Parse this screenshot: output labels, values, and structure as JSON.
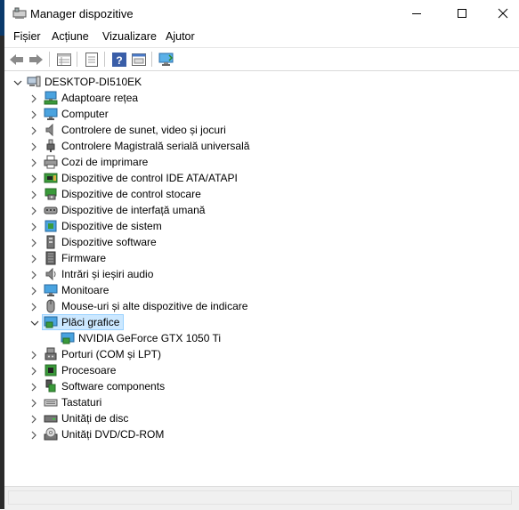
{
  "window": {
    "title": "Manager dispozitive"
  },
  "menu": [
    "Fișier",
    "Acțiune",
    "Vizualizare",
    "Ajutor"
  ],
  "toolbar": [
    "back-arrow-icon",
    "forward-arrow-icon",
    "properties-grid-icon",
    "document-icon",
    "help-icon",
    "panel-icon",
    "monitor-scan-icon"
  ],
  "tree": {
    "root": "DESKTOP-DI510EK",
    "categories": [
      {
        "label": "Adaptoare rețea",
        "icon": "network-icon"
      },
      {
        "label": "Computer",
        "icon": "computer-icon"
      },
      {
        "label": "Controlere de sunet, video și jocuri",
        "icon": "speaker-icon"
      },
      {
        "label": "Controlere Magistrală serială universală",
        "icon": "usb-icon"
      },
      {
        "label": "Cozi de imprimare",
        "icon": "printer-icon"
      },
      {
        "label": "Dispozitive de control IDE ATA/ATAPI",
        "icon": "ide-controller-icon"
      },
      {
        "label": "Dispozitive de control stocare",
        "icon": "storage-controller-icon"
      },
      {
        "label": "Dispozitive de interfață umană",
        "icon": "hid-icon"
      },
      {
        "label": "Dispozitive de sistem",
        "icon": "system-device-icon"
      },
      {
        "label": "Dispozitive software",
        "icon": "software-device-icon"
      },
      {
        "label": "Firmware",
        "icon": "firmware-icon"
      },
      {
        "label": "Intrări și ieșiri audio",
        "icon": "audio-io-icon"
      },
      {
        "label": "Monitoare",
        "icon": "monitor-icon"
      },
      {
        "label": "Mouse-uri și alte dispozitive de indicare",
        "icon": "mouse-icon"
      },
      {
        "label": "Plăci grafice",
        "icon": "display-adapter-icon",
        "expanded": true,
        "selected": true,
        "children": [
          {
            "label": "NVIDIA GeForce GTX 1050 Ti",
            "icon": "display-adapter-icon"
          }
        ]
      },
      {
        "label": "Porturi (COM și LPT)",
        "icon": "port-icon"
      },
      {
        "label": "Procesoare",
        "icon": "processor-icon"
      },
      {
        "label": "Software components",
        "icon": "software-component-icon"
      },
      {
        "label": "Tastaturi",
        "icon": "keyboard-icon"
      },
      {
        "label": "Unități de disc",
        "icon": "disk-drive-icon"
      },
      {
        "label": "Unități DVD/CD-ROM",
        "icon": "dvd-drive-icon"
      }
    ]
  },
  "colors": {
    "selection": "#cce8ff",
    "selection_border": "#99d1ff",
    "icon_blue": "#2c7fd0",
    "icon_green": "#3a9a3a"
  }
}
